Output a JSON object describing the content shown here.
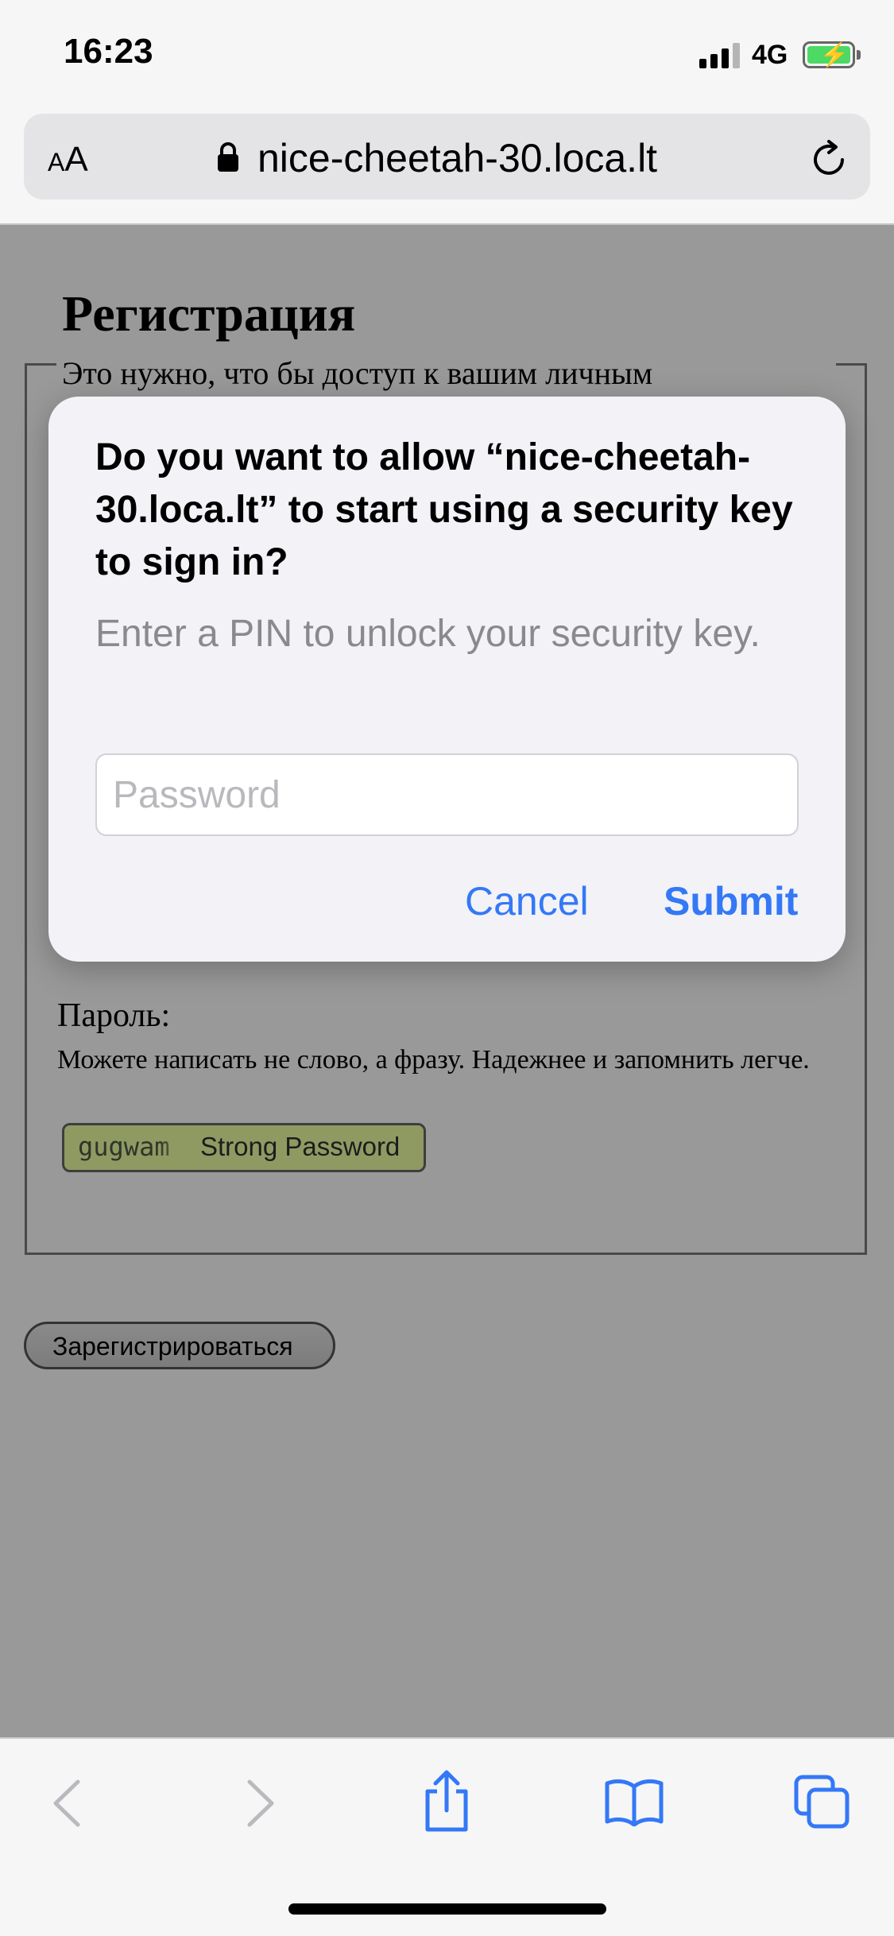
{
  "status_bar": {
    "time": "16:23",
    "network": "4G"
  },
  "browser": {
    "text_size_button": "AA",
    "url": "nice-cheetah-30.loca.lt"
  },
  "page": {
    "title": "Регистрация",
    "fieldset_legend": "Это нужно, что бы доступ к вашим личным",
    "password_label": "Пароль:",
    "password_hint": "Можете написать не слово, а фразу. Надежнее и запомнить легче.",
    "password_value": "gugwam",
    "password_strength": "Strong Password",
    "register_button": "Зарегистрироваться"
  },
  "dialog": {
    "title": "Do you want to allow “nice-cheetah-30.loca.lt” to start using a security key to sign in?",
    "message": "Enter a PIN to unlock your security key.",
    "input_placeholder": "Password",
    "cancel_label": "Cancel",
    "submit_label": "Submit"
  },
  "toolbar": {
    "items": [
      "back-icon",
      "forward-icon",
      "share-icon",
      "bookmarks-icon",
      "tabs-icon"
    ]
  },
  "colors": {
    "accent": "#3478f6",
    "battery": "#4cd964",
    "page_dim": "#999999"
  }
}
